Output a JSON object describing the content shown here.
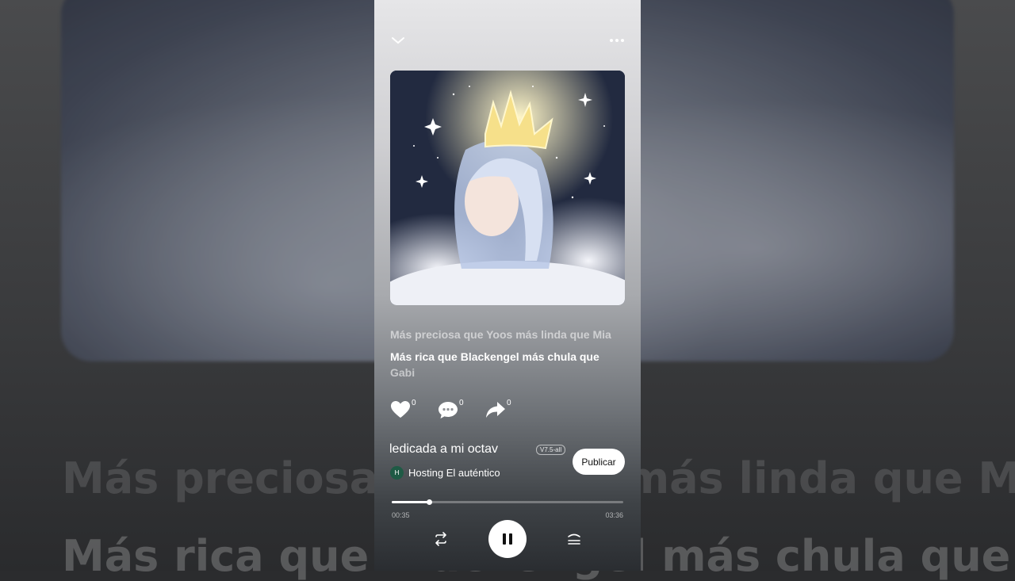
{
  "background": {
    "lyric_line_1": "Más preciosa que Yoos más linda que Mia",
    "lyric_line_2": "Más rica que Blackengel más chula que"
  },
  "header": {
    "collapse_icon": "chevron-down-icon",
    "more_icon": "more-horizontal-icon"
  },
  "lyrics": {
    "previous": "Más preciosa que Yoos más linda que Mia",
    "current_main": "Más rica que Blackengel más chula que",
    "current_tail": "Gabi"
  },
  "actions": {
    "like_count": "0",
    "comment_count": "0",
    "share_count": "0"
  },
  "song": {
    "title": "ledicada a mi octav",
    "version_badge": "V7.5-all",
    "author_initial": "H",
    "author": "Hosting El auténtico",
    "publish_label": "Publicar"
  },
  "player": {
    "current_time": "00:35",
    "total_time": "03:36",
    "progress": 0.162
  },
  "colors": {
    "accent": "#ffffff",
    "author_avatar": "#1f5a45"
  }
}
